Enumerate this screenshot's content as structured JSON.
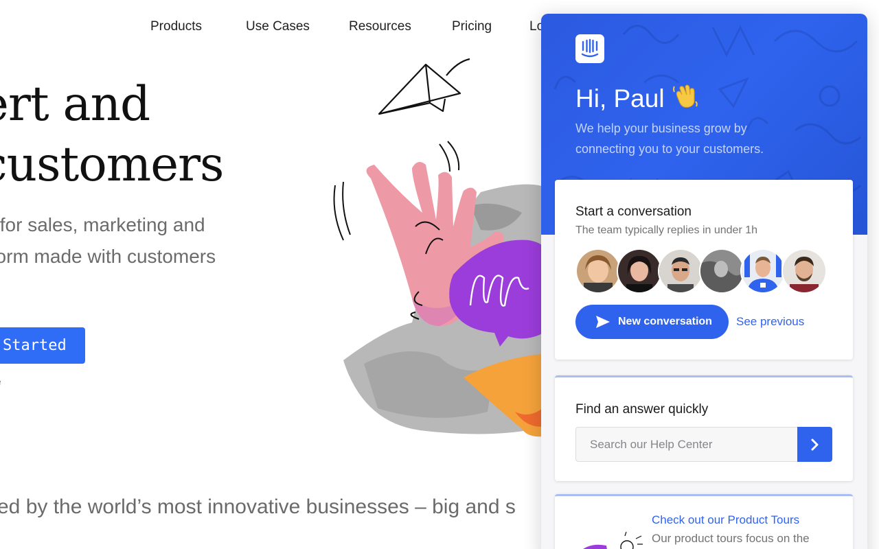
{
  "nav": {
    "items": [
      "Products",
      "Use Cases",
      "Resources",
      "Pricing",
      "Lo"
    ]
  },
  "hero": {
    "title_line1": "ert and",
    "title_line2": "customers",
    "subtitle_line1": "s for sales, marketing and",
    "subtitle_line2": "tform made with customers",
    "cta_label": "Started",
    "cta_note": "e"
  },
  "trusted": {
    "text": "ed by the world’s most innovative businesses – big and s"
  },
  "messenger": {
    "greeting": "Hi, Paul",
    "greeting_icon": "waving-hand-icon",
    "tagline": "We help your business grow by connecting you to your customers.",
    "conversation_card": {
      "title": "Start a conversation",
      "reply_time": "The team typically replies in under 1h",
      "avatars": [
        "team-member-1",
        "team-member-2",
        "team-member-3",
        "team-member-4",
        "team-member-5",
        "team-member-6"
      ],
      "new_conversation_label": "New conversation",
      "see_previous_label": "See previous"
    },
    "search_card": {
      "title": "Find an answer quickly",
      "placeholder": "Search our Help Center"
    },
    "tours_card": {
      "link": "Check out our Product Tours",
      "description": "Our product tours focus on the"
    },
    "colors": {
      "accent": "#2f63ee",
      "header": "#2c5ae0"
    }
  }
}
